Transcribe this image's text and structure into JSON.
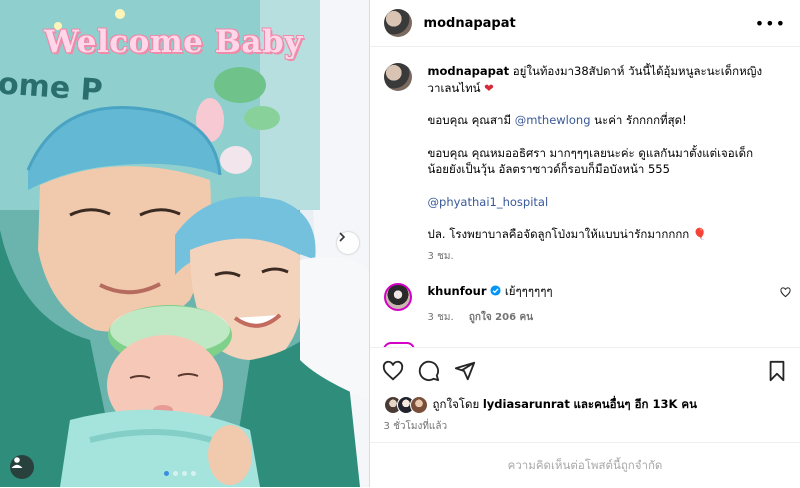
{
  "post": {
    "image": {
      "banner_text": "Welcome Baby",
      "background_text": "ome P",
      "carousel_dots": 4,
      "active_dot": 1
    },
    "header": {
      "username": "modnapapat",
      "more_icon": "more-horizontal-icon"
    },
    "caption": {
      "username": "modnapapat",
      "line1": "อยู่ในท้องมา38สัปดาห์ วันนี้ได้อุ้มหนูละนะเด็กหญิงวาเลนไทน์",
      "line1_emoji": "❤",
      "thanks1_prefix": "ขอบคุณ คุณสามี",
      "thanks1_mention": "@mthewlong",
      "thanks1_suffix": "นะค่า รักกกกที่สุด!",
      "thanks2": "ขอบคุณ คุณหมออธิศรา มากๆๆๆเลยนะค่ะ ดูแลกันมาตั้งแต่เจอเด็กน้อยยังเป็นวุ้น อัลตราซาวด์ก็รอบก็มือบังหน้า 555",
      "hospital_mention": "@phyathai1_hospital",
      "ps": "ปล. โรงพยาบาลคือจัดลูกโป่งมาให้แบบน่ารักมากกกก",
      "ps_emoji": "🎈",
      "time": "3 ชม."
    },
    "comment": {
      "username": "khunfour",
      "verified": true,
      "text": "เย้ๆๆๆๆๆๆ",
      "time": "3 ชม.",
      "likes": "ถูกใจ 206 คน"
    },
    "actions": {
      "like_icon": "heart-icon",
      "comment_icon": "comment-icon",
      "share_icon": "send-icon",
      "save_icon": "bookmark-icon"
    },
    "likes": {
      "prefix": "ถูกใจโดย",
      "user": "lydiasarunrat",
      "suffix": "และคนอื่นๆ อีก 13K คน"
    },
    "posted_ago": "3 ชั่วโมงที่แล้ว",
    "comments_limited": "ความคิดเห็นต่อโพสต์นี้ถูกจำกัด"
  },
  "colors": {
    "link": "#385898",
    "verified": "#0095f6",
    "story_ring": "#d300c5",
    "muted": "#737373"
  }
}
